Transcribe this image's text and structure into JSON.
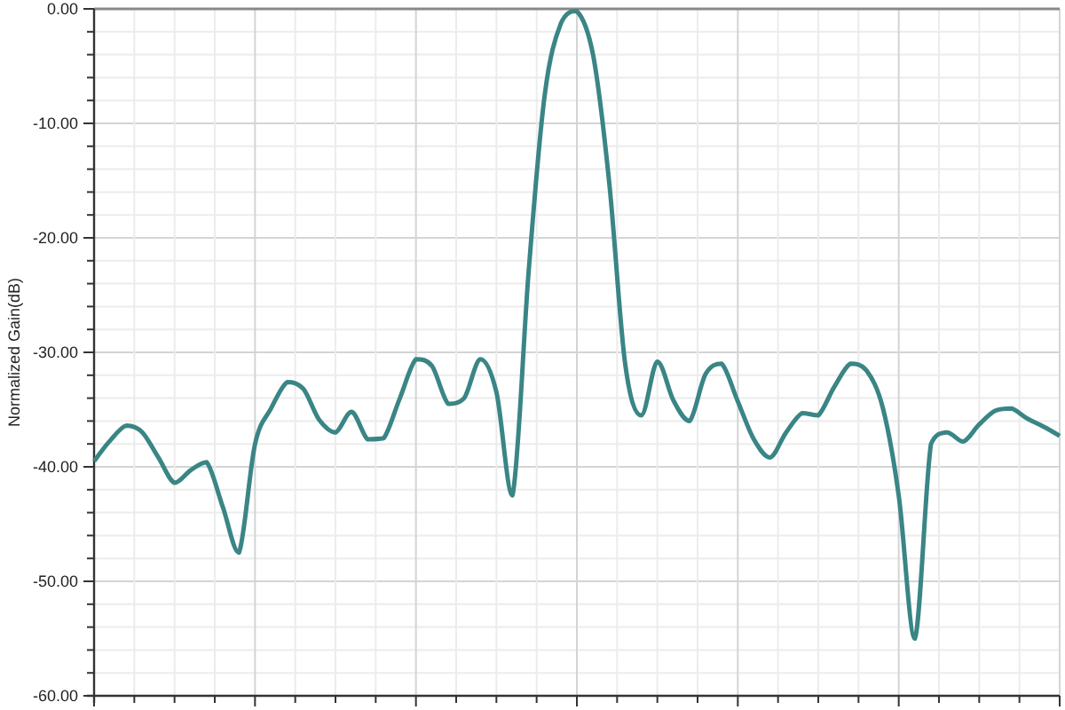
{
  "chart": {
    "chart_data": {
      "type": "line",
      "grid": true,
      "ylabel": "Normalized Gain(dB)",
      "ylim": [
        -60,
        0
      ],
      "yticks": [
        {
          "value": 0,
          "label": "0.00"
        },
        {
          "value": -10,
          "label": "-10.00"
        },
        {
          "value": -20,
          "label": "-20.00"
        },
        {
          "value": -30,
          "label": "-30.00"
        },
        {
          "value": -40,
          "label": "-40.00"
        },
        {
          "value": -50,
          "label": "-50.00"
        },
        {
          "value": -60,
          "label": "-60.00"
        }
      ],
      "series": [
        {
          "color": "#3a8585",
          "values": [
            -39.5,
            -37.7,
            -36.4,
            -37,
            -39.2,
            -41.4,
            -40.3,
            -39.6,
            -43.5,
            -47.5,
            -38,
            -34.9,
            -32.6,
            -33.2,
            -35.9,
            -37,
            -35.2,
            -37.6,
            -37.5,
            -34,
            -30.6,
            -31.2,
            -34.5,
            -34,
            -30.6,
            -33.5,
            -42.5,
            -23,
            -7.5,
            -1.3,
            -0.2,
            -4,
            -15,
            -31,
            -35.5,
            -30.8,
            -34.2,
            -36,
            -31.9,
            -31,
            -34.3,
            -37.6,
            -39.2,
            -37,
            -35.3,
            -35.5,
            -33,
            -31,
            -31.6,
            -34.8,
            -42.5,
            -55,
            -38,
            -37,
            -37.8,
            -36.3,
            -35.1,
            -34.9,
            -35.8,
            -36.5,
            -37.3
          ]
        }
      ]
    }
  }
}
